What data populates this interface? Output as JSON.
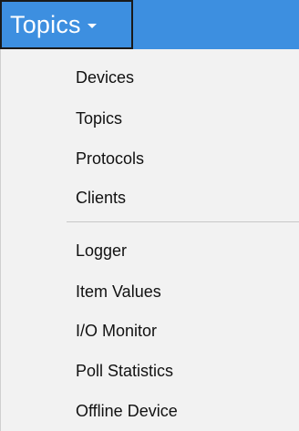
{
  "menu_button": {
    "label": "Topics"
  },
  "dropdown": {
    "group1": [
      {
        "label": "Devices"
      },
      {
        "label": "Topics"
      },
      {
        "label": "Protocols"
      },
      {
        "label": "Clients"
      }
    ],
    "group2": [
      {
        "label": "Logger"
      },
      {
        "label": "Item Values"
      },
      {
        "label": "I/O Monitor"
      },
      {
        "label": "Poll Statistics"
      },
      {
        "label": "Offline Device"
      }
    ]
  },
  "colors": {
    "accent": "#3d8fe0",
    "menu_background": "#f2f2f2",
    "text": "#111111"
  }
}
